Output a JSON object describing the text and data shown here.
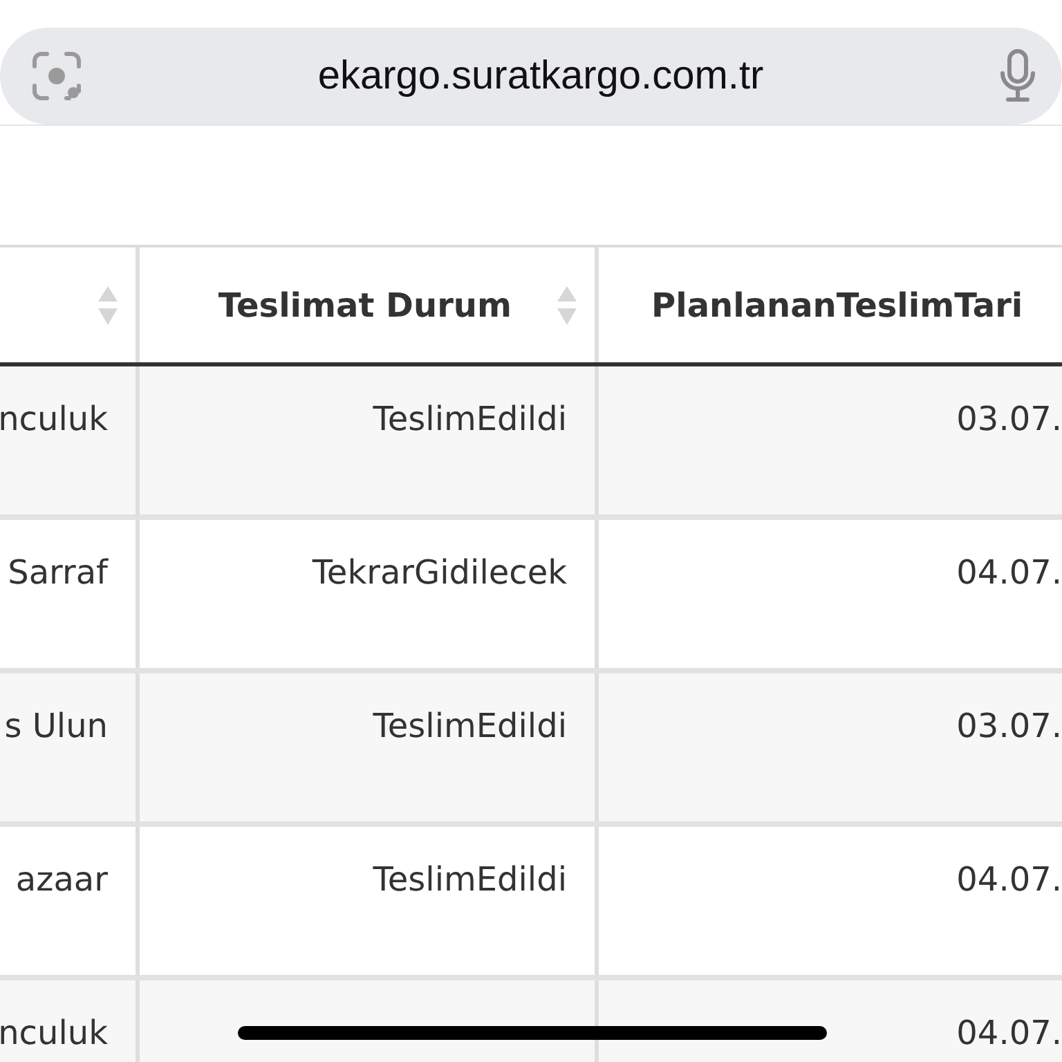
{
  "address_bar": {
    "url": "ekargo.suratkargo.com.tr"
  },
  "table": {
    "columns": [
      {
        "kind": "sortable"
      },
      {
        "label": "Teslimat Durum",
        "kind": "sortable"
      },
      {
        "label": "PlanlananTeslimTari",
        "kind": "plain"
      }
    ],
    "rows": [
      {
        "cells": [
          "nculuk",
          "TeslimEdildi",
          "03.07."
        ]
      },
      {
        "cells": [
          "Sarraf",
          "TekrarGidilecek",
          "04.07."
        ]
      },
      {
        "cells": [
          "s Ulun",
          "TeslimEdildi",
          "03.07."
        ]
      },
      {
        "cells": [
          "azaar",
          "TeslimEdildi",
          "04.07."
        ]
      },
      {
        "cells": [
          "nculuk",
          null,
          "04.07."
        ]
      }
    ]
  }
}
